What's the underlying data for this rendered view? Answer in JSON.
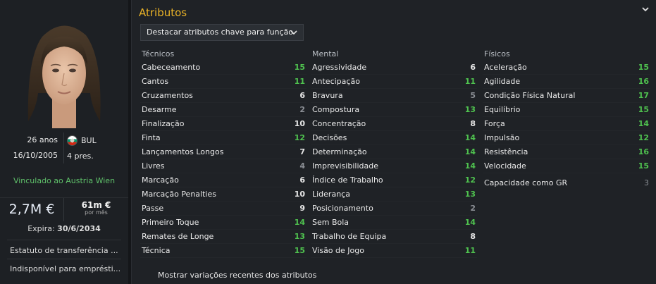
{
  "player": {
    "age": "26 anos",
    "nation": "BUL",
    "dob": "16/10/2005",
    "caps": "4 pres.",
    "club_status": "Vinculado ao Austria Wien",
    "value": "2,7M €",
    "wage": "61m €",
    "wage_period": "por mês",
    "expires_label": "Expira:",
    "expires_date": "30/6/2034",
    "transfer_status": "Estatuto de transferência ...",
    "loan_status": "Indisponível para emprésti..."
  },
  "attributes": {
    "title": "Atributos",
    "highlight_dropdown": "Destacar atributos chave para função",
    "columns": [
      {
        "title": "Técnicos",
        "items": [
          {
            "name": "Cabeceamento",
            "value": "15",
            "tone": "g"
          },
          {
            "name": "Cantos",
            "value": "11",
            "tone": "g"
          },
          {
            "name": "Cruzamentos",
            "value": "6",
            "tone": "w"
          },
          {
            "name": "Desarme",
            "value": "2",
            "tone": "gr"
          },
          {
            "name": "Finalização",
            "value": "10",
            "tone": "w"
          },
          {
            "name": "Finta",
            "value": "12",
            "tone": "g"
          },
          {
            "name": "Lançamentos Longos",
            "value": "7",
            "tone": "w"
          },
          {
            "name": "Livres",
            "value": "4",
            "tone": "gr"
          },
          {
            "name": "Marcação",
            "value": "6",
            "tone": "w"
          },
          {
            "name": "Marcação Penalties",
            "value": "10",
            "tone": "w"
          },
          {
            "name": "Passe",
            "value": "9",
            "tone": "w"
          },
          {
            "name": "Primeiro Toque",
            "value": "14",
            "tone": "g"
          },
          {
            "name": "Remates de Longe",
            "value": "13",
            "tone": "g"
          },
          {
            "name": "Técnica",
            "value": "15",
            "tone": "g"
          }
        ]
      },
      {
        "title": "Mental",
        "items": [
          {
            "name": "Agressividade",
            "value": "6",
            "tone": "w"
          },
          {
            "name": "Antecipação",
            "value": "11",
            "tone": "g"
          },
          {
            "name": "Bravura",
            "value": "5",
            "tone": "gr"
          },
          {
            "name": "Compostura",
            "value": "13",
            "tone": "g"
          },
          {
            "name": "Concentração",
            "value": "8",
            "tone": "w"
          },
          {
            "name": "Decisões",
            "value": "14",
            "tone": "g"
          },
          {
            "name": "Determinação",
            "value": "14",
            "tone": "g"
          },
          {
            "name": "Imprevisibilidade",
            "value": "14",
            "tone": "g"
          },
          {
            "name": "Índice de Trabalho",
            "value": "12",
            "tone": "g"
          },
          {
            "name": "Liderança",
            "value": "13",
            "tone": "g"
          },
          {
            "name": "Posicionamento",
            "value": "2",
            "tone": "gr"
          },
          {
            "name": "Sem Bola",
            "value": "14",
            "tone": "g"
          },
          {
            "name": "Trabalho de Equipa",
            "value": "8",
            "tone": "w"
          },
          {
            "name": "Visão de Jogo",
            "value": "11",
            "tone": "g"
          }
        ]
      },
      {
        "title": "Físicos",
        "items": [
          {
            "name": "Aceleração",
            "value": "15",
            "tone": "g"
          },
          {
            "name": "Agilidade",
            "value": "16",
            "tone": "g"
          },
          {
            "name": "Condição Física Natural",
            "value": "17",
            "tone": "g"
          },
          {
            "name": "Equilíbrio",
            "value": "15",
            "tone": "g"
          },
          {
            "name": "Força",
            "value": "14",
            "tone": "g"
          },
          {
            "name": "Impulsão",
            "value": "12",
            "tone": "g"
          },
          {
            "name": "Resistência",
            "value": "16",
            "tone": "g"
          },
          {
            "name": "Velocidade",
            "value": "15",
            "tone": "g"
          }
        ]
      }
    ],
    "gk_ability": {
      "name": "Capacidade como GR",
      "value": "3",
      "tone": "gr"
    },
    "footer_toggle": "Mostrar variações recentes dos atributos"
  },
  "colors": {
    "accent": "#e9b227",
    "good": "#4fc24f",
    "club": "#5fc06a"
  }
}
